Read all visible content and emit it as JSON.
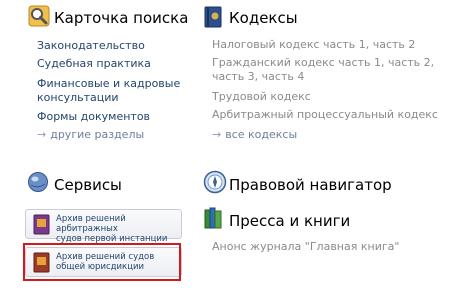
{
  "search_card": {
    "title": "Карточка поиска",
    "links": [
      "Законодательство",
      "Судебная практика",
      "Финансовые и кадровые",
      "консультации",
      "Формы документов"
    ],
    "more": "другие разделы"
  },
  "codexes": {
    "title": "Кодексы",
    "items": [
      "Налоговый кодекс часть 1, часть 2",
      "Гражданский кодекс часть 1, часть 2,",
      "часть 3, часть 4",
      "Трудовой кодекс",
      "Арбитражный процессуальный кодекс"
    ],
    "more": "все кодексы"
  },
  "services": {
    "title": "Сервисы",
    "buttons": [
      {
        "line1": "Архив решений арбитражных",
        "line2": "судов первой инстанции"
      },
      {
        "line1": "Архив решений судов",
        "line2": "общей юрисдикции"
      }
    ]
  },
  "legal_navigator": {
    "title": "Правовой навигатор"
  },
  "press": {
    "title": "Пресса и книги",
    "item": "Анонс журнала \"Главная книга\""
  },
  "colors": {
    "link": "#24466b",
    "muted": "#8a8a8a",
    "highlight": "#d11b1b"
  }
}
